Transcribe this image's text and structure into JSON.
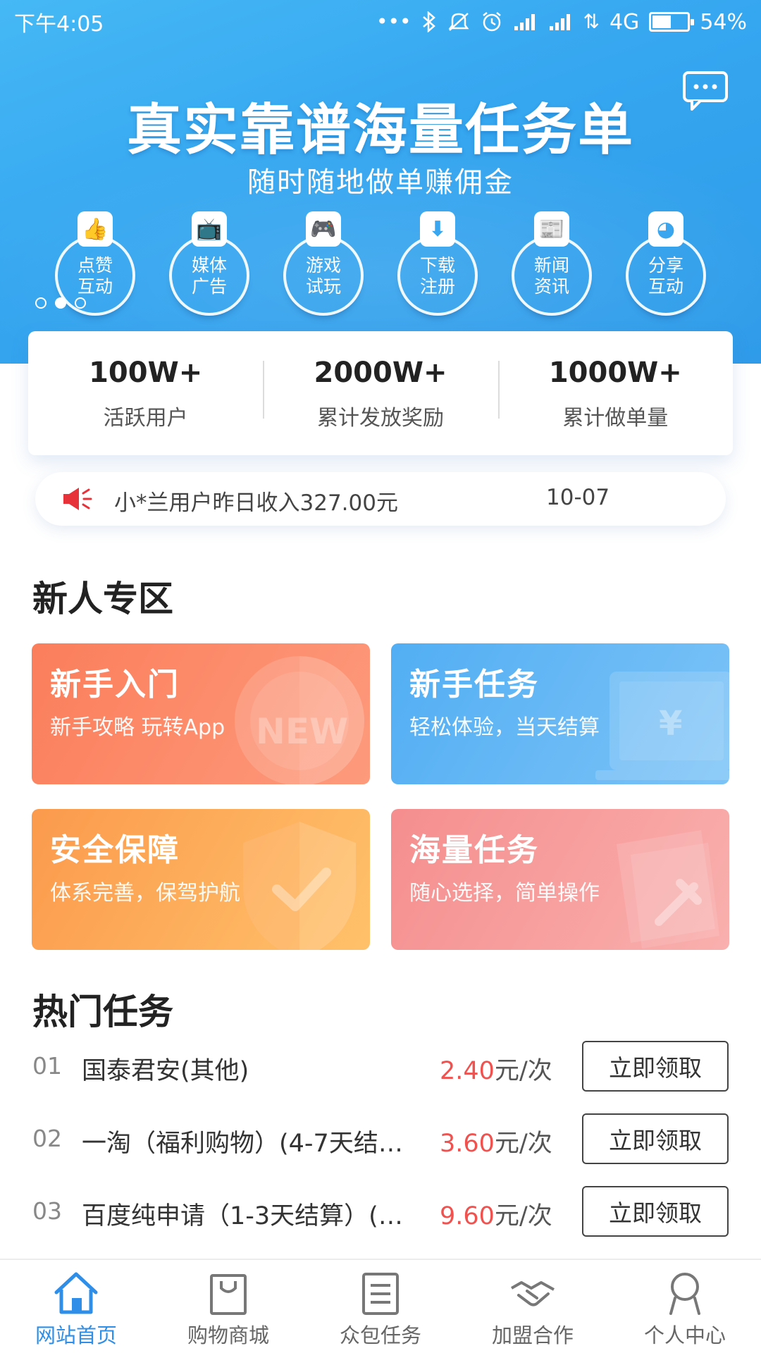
{
  "status_bar": {
    "time": "下午4:05",
    "network": "4G",
    "battery": "54%",
    "battery_level": 0.54
  },
  "banner": {
    "title": "真实靠谱海量任务单",
    "subtitle": "随时随地做单赚佣金",
    "categories": [
      {
        "line1": "点赞",
        "line2": "互动",
        "icon": "thumbs-up-icon"
      },
      {
        "line1": "媒体",
        "line2": "广告",
        "icon": "tv-icon"
      },
      {
        "line1": "游戏",
        "line2": "试玩",
        "icon": "gamepad-icon"
      },
      {
        "line1": "下载",
        "line2": "注册",
        "icon": "download-icon"
      },
      {
        "line1": "新闻",
        "line2": "资讯",
        "icon": "newspaper-icon"
      },
      {
        "line1": "分享",
        "line2": "互动",
        "icon": "share-icon"
      }
    ],
    "carousel_page": 2,
    "carousel_pages": 3
  },
  "stats": [
    {
      "value": "100W+",
      "label": "活跃用户"
    },
    {
      "value": "2000W+",
      "label": "累计发放奖励"
    },
    {
      "value": "1000W+",
      "label": "累计做单量"
    }
  ],
  "notice": {
    "text": "小*兰用户昨日收入327.00元",
    "date": "10-07"
  },
  "newbie": {
    "title": "新人专区",
    "cards": [
      {
        "title": "新手入门",
        "desc": "新手攻略 玩转App",
        "deco_text": "NEW"
      },
      {
        "title": "新手任务",
        "desc": "轻松体验，当天结算",
        "deco_text": "¥"
      },
      {
        "title": "安全保障",
        "desc": "体系完善，保驾护航"
      },
      {
        "title": "海量任务",
        "desc": "随心选择，简单操作"
      }
    ]
  },
  "hot": {
    "title": "热门任务",
    "tasks": [
      {
        "num": "01",
        "name": "国泰君安(其他)",
        "price": "2.40",
        "unit": "元/次",
        "button": "立即领取"
      },
      {
        "num": "02",
        "name": "一淘（福利购物）(4-7天结…",
        "price": "3.60",
        "unit": "元/次",
        "button": "立即领取"
      },
      {
        "num": "03",
        "name": "百度纯申请（1-3天结算）(…",
        "price": "9.60",
        "unit": "元/次",
        "button": "立即领取"
      }
    ]
  },
  "bottom_nav": [
    {
      "label": "网站首页",
      "icon": "home-icon",
      "active": true
    },
    {
      "label": "购物商城",
      "icon": "shopping-bag-icon",
      "active": false
    },
    {
      "label": "众包任务",
      "icon": "task-list-icon",
      "active": false
    },
    {
      "label": "加盟合作",
      "icon": "handshake-icon",
      "active": false
    },
    {
      "label": "个人中心",
      "icon": "user-icon",
      "active": false
    }
  ],
  "colors": {
    "banner": "#3aa8f2",
    "price": "#f0524f",
    "nav_active": "#2f8fe8",
    "notice_icon": "#e8323a"
  }
}
